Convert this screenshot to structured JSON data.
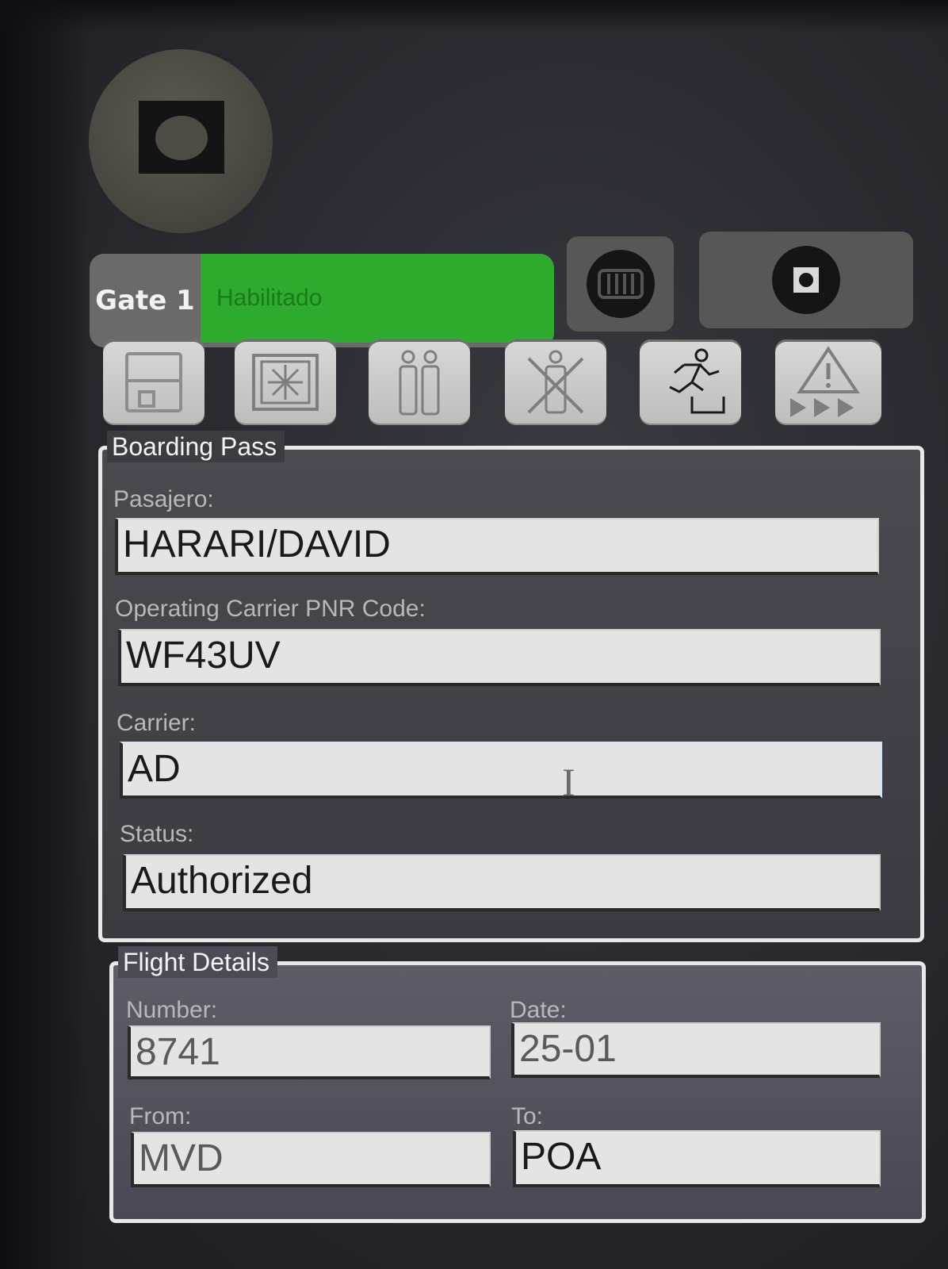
{
  "gate": {
    "label": "Gate 1",
    "status": "Habilitado",
    "status_color": "#2eaa2e"
  },
  "toolbar": {
    "icons": [
      "save-icon",
      "gate-open-icon",
      "passengers-icon",
      "no-passage-icon",
      "running-exit-icon",
      "warning-forward-icon"
    ]
  },
  "boarding_pass": {
    "title": "Boarding Pass",
    "passenger_label": "Pasajero:",
    "passenger_value": "HARARI/DAVID",
    "pnr_label": "Operating Carrier PNR Code:",
    "pnr_value": "WF43UV",
    "carrier_label": "Carrier:",
    "carrier_value": "AD",
    "status_label": "Status:",
    "status_value": "Authorized"
  },
  "flight_details": {
    "title": "Flight Details",
    "number_label": "Number:",
    "number_value": "8741",
    "date_label": "Date:",
    "date_value": "25-01",
    "from_label": "From:",
    "from_value": "MVD",
    "to_label": "To:",
    "to_value": "POA"
  }
}
